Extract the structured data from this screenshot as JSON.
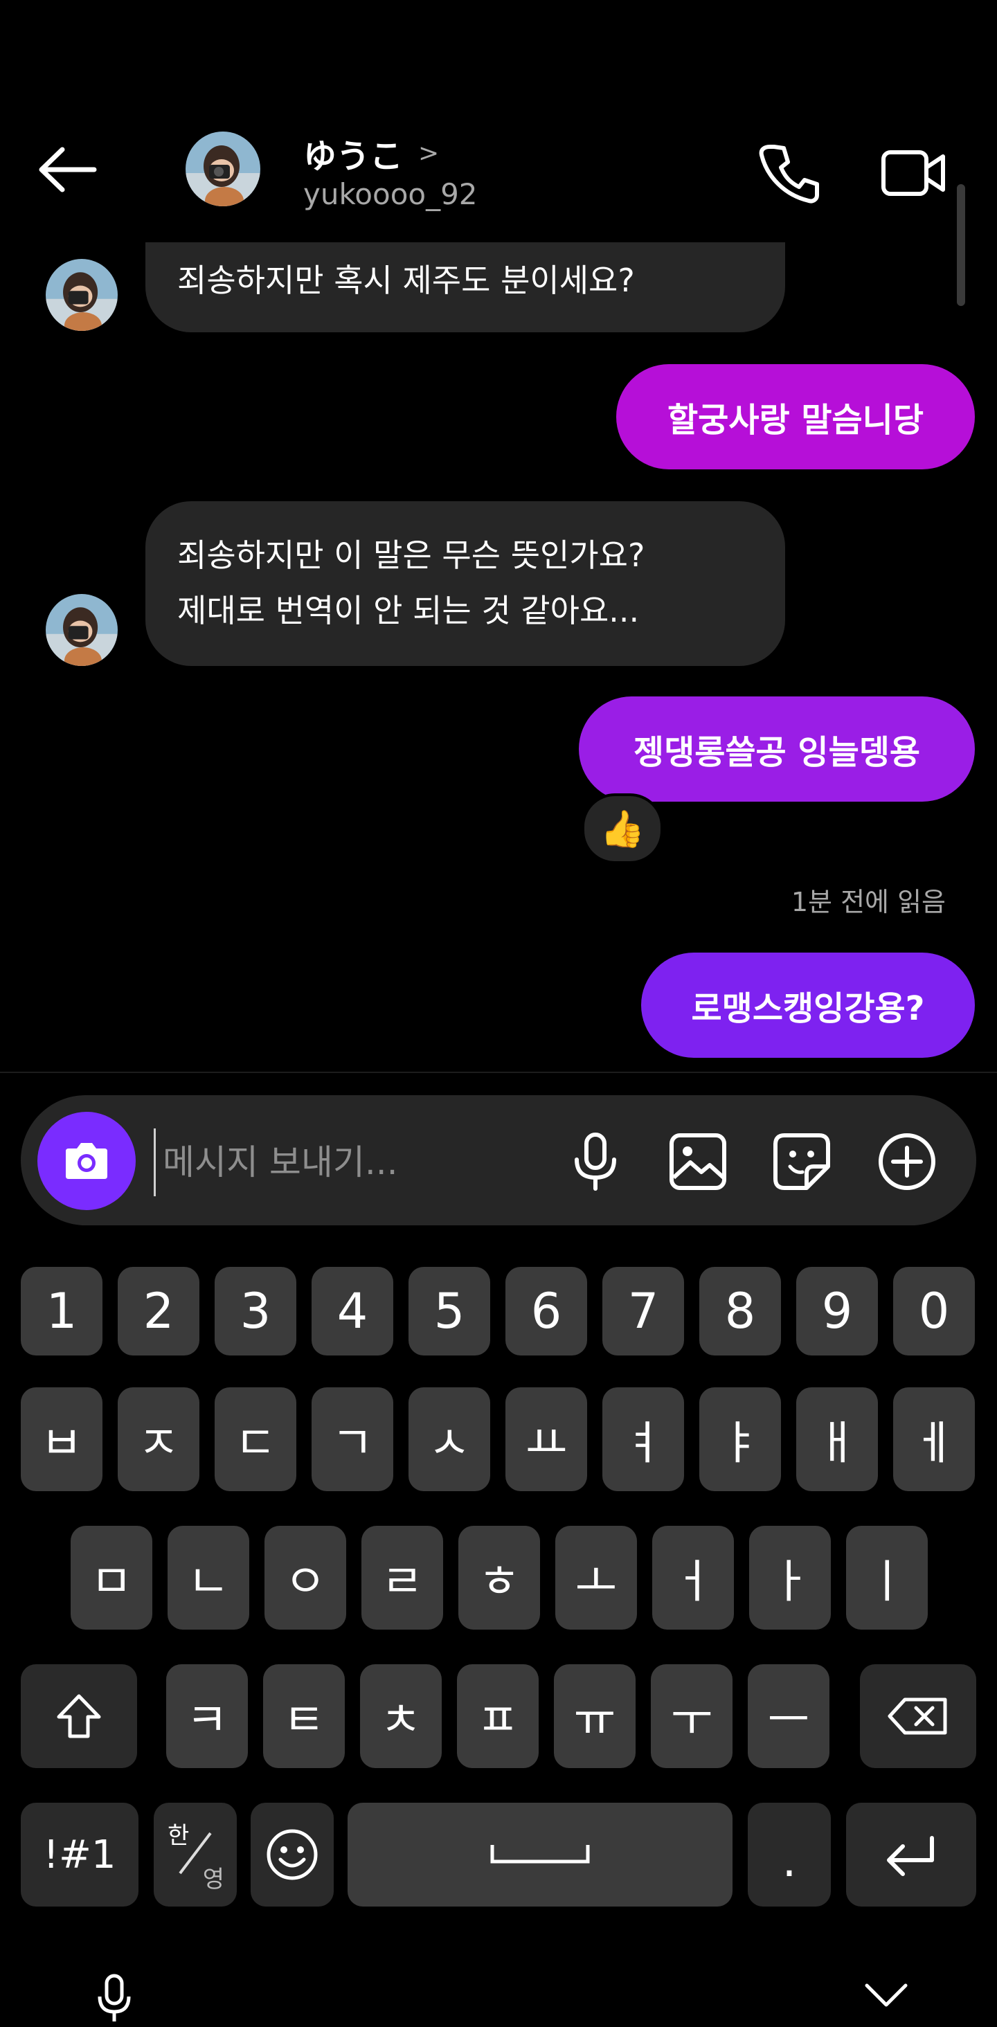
{
  "header": {
    "name": "ゆうこ",
    "chevron": ">",
    "username": "yukoooo_92"
  },
  "messages": [
    {
      "side": "in",
      "text": "죄송하지만 혹시 제주도 분이세요?"
    },
    {
      "side": "out",
      "text": "할궁사랑 말슴니당",
      "color": "#b60fd8"
    },
    {
      "side": "in",
      "lines": [
        "죄송하지만 이 말은 무슨 뜻인가요?",
        "제대로 번역이 안 되는 것 같아요..."
      ]
    },
    {
      "side": "out",
      "text": "젱댕롱쓸공 잉늘뎅용",
      "color": "#9a1ee6",
      "reaction": "👍"
    },
    {
      "side": "out",
      "text": "로맹스캥잉강용?",
      "color": "#7e22f0"
    }
  ],
  "read_status": "1분 전에 읽음",
  "composer": {
    "placeholder": "메시지 보내기..."
  },
  "keyboard": {
    "row_numbers": [
      "1",
      "2",
      "3",
      "4",
      "5",
      "6",
      "7",
      "8",
      "9",
      "0"
    ],
    "row1": [
      "ㅂ",
      "ㅈ",
      "ㄷ",
      "ㄱ",
      "ㅅ",
      "ㅛ",
      "ㅕ",
      "ㅑ",
      "ㅐ",
      "ㅔ"
    ],
    "row2": [
      "ㅁ",
      "ㄴ",
      "ㅇ",
      "ㄹ",
      "ㅎ",
      "ㅗ",
      "ㅓ",
      "ㅏ",
      "ㅣ"
    ],
    "row3": [
      "ㅋ",
      "ㅌ",
      "ㅊ",
      "ㅍ",
      "ㅠ",
      "ㅜ",
      "ㅡ"
    ],
    "symbols": "!#1",
    "lang_top": "한",
    "lang_bottom": "영",
    "period": "."
  },
  "colors": {
    "accent": "#7a2cff",
    "incoming_bubble": "#262626"
  }
}
